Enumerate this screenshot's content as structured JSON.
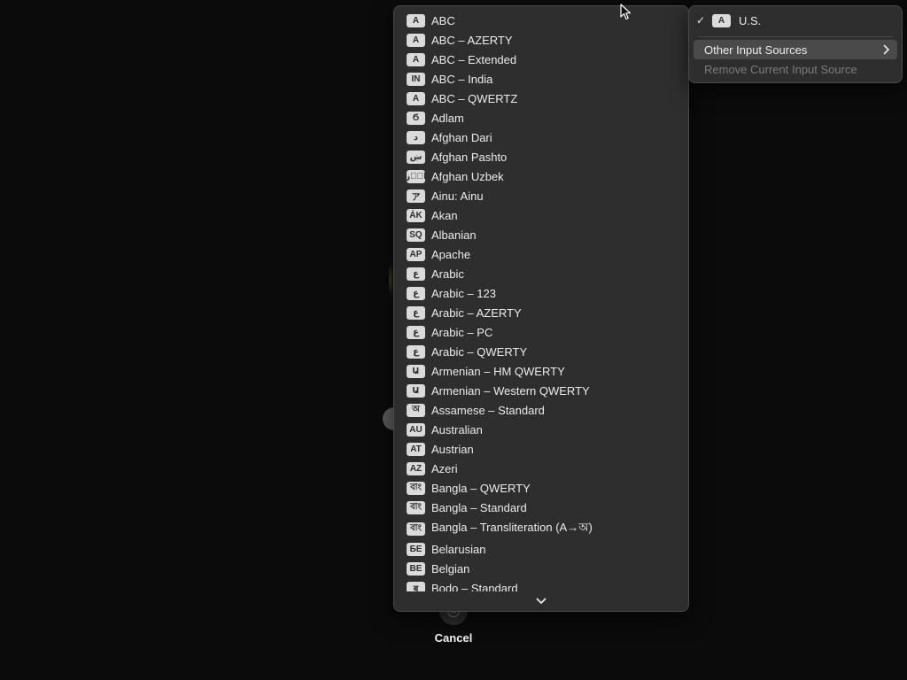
{
  "dropdown": {
    "items": [
      {
        "badge": "A",
        "label": "ABC"
      },
      {
        "badge": "A",
        "label": "ABC – AZERTY"
      },
      {
        "badge": "A",
        "label": "ABC – Extended"
      },
      {
        "badge": "IN",
        "label": "ABC – India"
      },
      {
        "badge": "A",
        "label": "ABC – QWERTZ"
      },
      {
        "badge": "Ϭ",
        "label": "Adlam"
      },
      {
        "badge": "د",
        "label": "Afghan Dari"
      },
      {
        "badge": "ښ",
        "label": "Afghan Pashto"
      },
      {
        "badge": "اوٛز",
        "label": "Afghan Uzbek"
      },
      {
        "badge": "ア",
        "label": "Ainu: Ainu"
      },
      {
        "badge": "ÁK",
        "label": "Akan"
      },
      {
        "badge": "SQ",
        "label": "Albanian"
      },
      {
        "badge": "AP",
        "label": "Apache"
      },
      {
        "badge": "ع",
        "label": "Arabic"
      },
      {
        "badge": "ع",
        "label": "Arabic – 123"
      },
      {
        "badge": "ع",
        "label": "Arabic – AZERTY"
      },
      {
        "badge": "ع",
        "label": "Arabic – PC"
      },
      {
        "badge": "ع",
        "label": "Arabic – QWERTY"
      },
      {
        "badge": "Ա",
        "label": "Armenian – HM QWERTY"
      },
      {
        "badge": "Ա",
        "label": "Armenian – Western QWERTY"
      },
      {
        "badge": "অ",
        "label": "Assamese – Standard"
      },
      {
        "badge": "AU",
        "label": "Australian"
      },
      {
        "badge": "AT",
        "label": "Austrian"
      },
      {
        "badge": "AZ",
        "label": "Azeri"
      },
      {
        "badge": "বাং",
        "label": "Bangla – QWERTY"
      },
      {
        "badge": "বাং",
        "label": "Bangla – Standard"
      },
      {
        "badge": "বাং",
        "label": "Bangla – Transliteration (A→অ)"
      },
      {
        "badge": "БЕ",
        "label": "Belarusian"
      },
      {
        "badge": "BE",
        "label": "Belgian"
      },
      {
        "badge": "ब",
        "label": "Bodo – Standard"
      }
    ],
    "scroll_icon": "chevron-down-icon"
  },
  "submenu": {
    "current": {
      "check": "✓",
      "badge": "A",
      "label": "U.S."
    },
    "other_sources_label": "Other Input Sources",
    "remove_label": "Remove Current Input Source"
  },
  "cancel": {
    "label": "Cancel",
    "icon": "cancel-icon"
  },
  "colors": {
    "menu_bg": "#2e2e2e",
    "badge_bg": "#dadada",
    "highlight": "#4a4a4a",
    "disabled_text": "#7b7b7b"
  }
}
